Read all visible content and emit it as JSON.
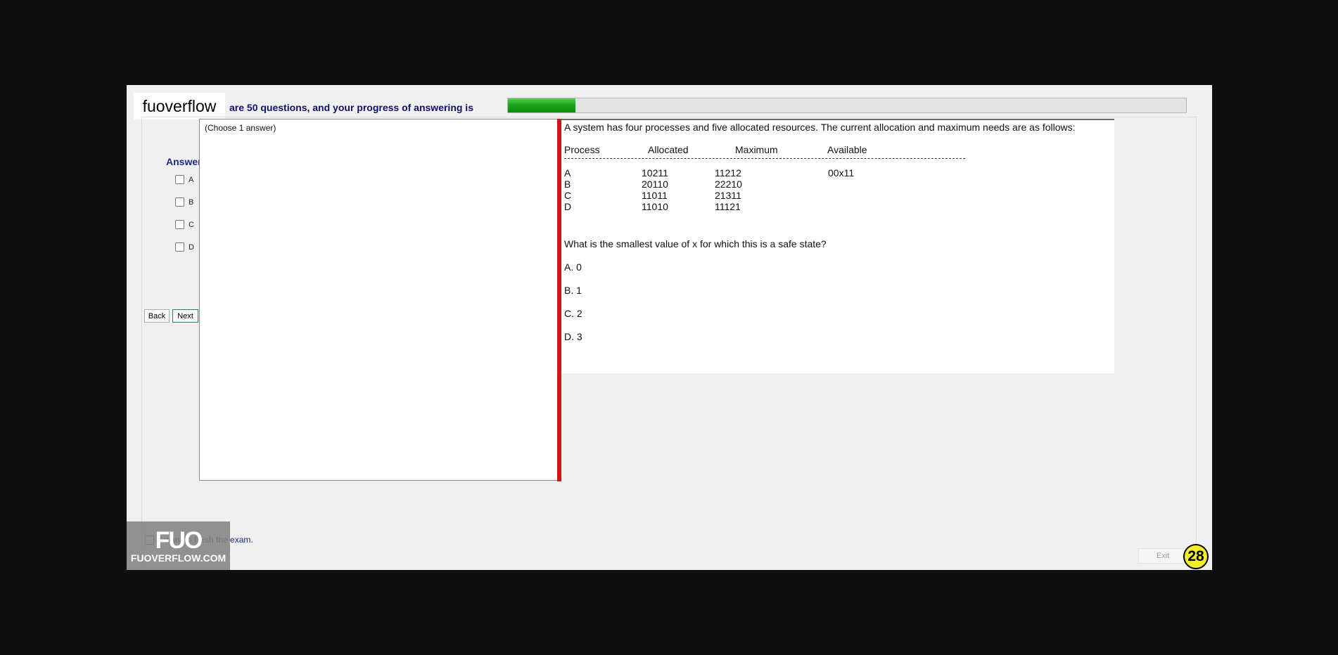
{
  "header": {
    "brand": "fuoverflow",
    "progress_text": "are 50 questions, and your progress of answering is",
    "progress": 0.1
  },
  "answer": {
    "title": "Answer",
    "options": [
      "A",
      "B",
      "C",
      "D"
    ],
    "back_label": "Back",
    "next_label": "Next",
    "choose_hint": "(Choose 1 answer)"
  },
  "question": {
    "intro": "A system has four processes and five allocated resources. The current allocation and maximum needs are as follows:",
    "headers": [
      "Process",
      "Allocated",
      "Maximum",
      "Available"
    ],
    "rows": [
      [
        "A",
        "10211",
        "11212",
        "00x11"
      ],
      [
        "B",
        "20110",
        "22210",
        ""
      ],
      [
        "C",
        "11011",
        "21311",
        ""
      ],
      [
        "D",
        "11010",
        "11121",
        ""
      ]
    ],
    "prompt": "What is the smallest value of x for which this is a safe state?",
    "choices": [
      "A.  0",
      "B.  1",
      "C.  2",
      "D.  3"
    ]
  },
  "footer": {
    "finish_text": "I want to finish the exam.",
    "watermark_logo": "FUO",
    "watermark_text": "FUOVERFLOW.COM",
    "exit_label": "Exit",
    "badge": "28"
  }
}
